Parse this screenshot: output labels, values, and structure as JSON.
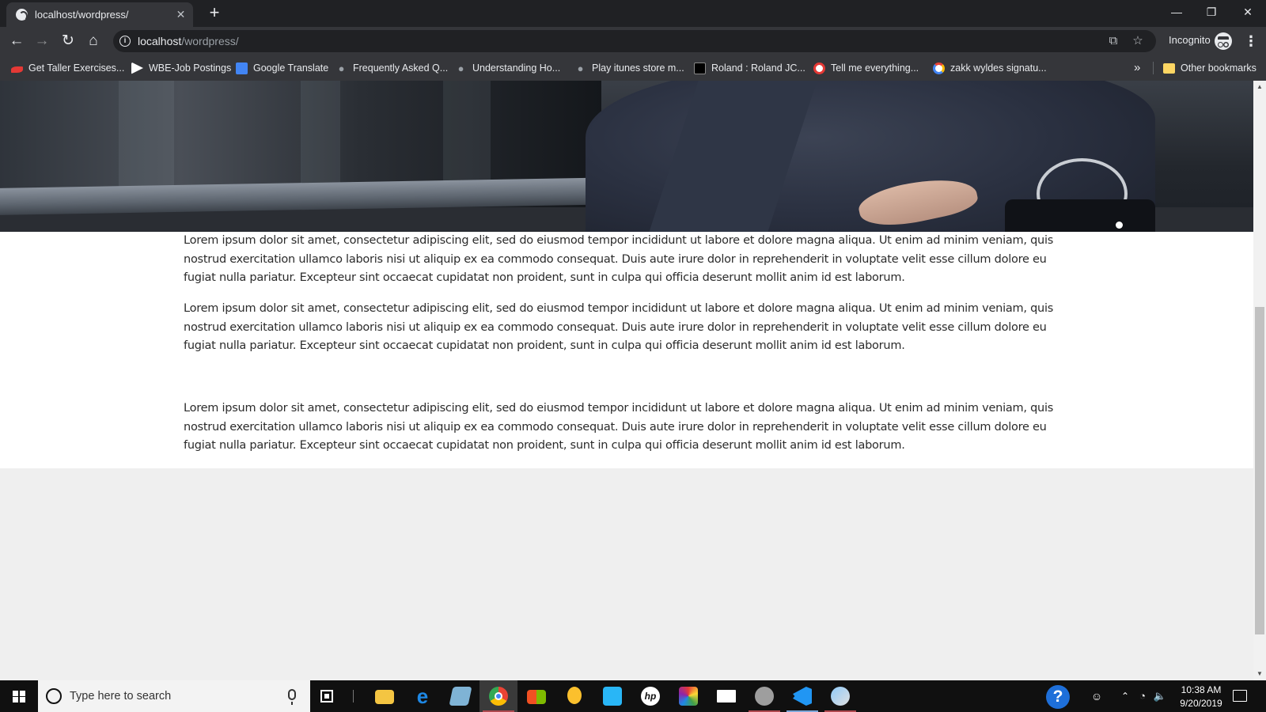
{
  "browser": {
    "tab_title": "localhost/wordpress/",
    "url_host": "localhost",
    "url_path": "/wordpress/",
    "profile_label": "Incognito",
    "window_controls": {
      "minimize": "—",
      "restore": "❐",
      "close": "✕"
    }
  },
  "bookmarks": {
    "items": [
      {
        "label": "Get Taller Exercises...",
        "icon": "red-swoosh-icon",
        "color": "#e53935"
      },
      {
        "label": "WBE-Job Postings",
        "icon": "arrow-logo-icon",
        "color": "#ffffff"
      },
      {
        "label": "Google Translate",
        "icon": "google-translate-icon",
        "color": "#4285f4"
      },
      {
        "label": "Frequently Asked Q...",
        "icon": "apple-icon",
        "color": "#9aa0a6"
      },
      {
        "label": "Understanding Ho...",
        "icon": "apple-icon",
        "color": "#9aa0a6"
      },
      {
        "label": "Play itunes store m...",
        "icon": "apple-icon",
        "color": "#9aa0a6"
      },
      {
        "label": "Roland : Roland JC...",
        "icon": "roland-icon",
        "color": "#000000"
      },
      {
        "label": "Tell me everything...",
        "icon": "target-icon",
        "color": "#e53935"
      },
      {
        "label": "zakk wyldes signatu...",
        "icon": "google-icon",
        "color": "#ffffff"
      }
    ],
    "more": "»",
    "other_label": "Other bookmarks"
  },
  "page": {
    "paragraphs": [
      "Lorem ipsum dolor sit amet, consectetur adipiscing elit, sed do eiusmod tempor incididunt ut labore et dolore magna aliqua. Ut enim ad minim veniam, quis nostrud exercitation ullamco laboris nisi ut aliquip ex ea commodo consequat. Duis aute irure dolor in reprehenderit in voluptate velit esse cillum dolore eu fugiat nulla pariatur. Excepteur sint occaecat cupidatat non proident, sunt in culpa qui officia deserunt mollit anim id est laborum.",
      "Lorem ipsum dolor sit amet, consectetur adipiscing elit, sed do eiusmod tempor incididunt ut labore et dolore magna aliqua. Ut enim ad minim veniam, quis nostrud exercitation ullamco laboris nisi ut aliquip ex ea commodo consequat. Duis aute irure dolor in reprehenderit in voluptate velit esse cillum dolore eu fugiat nulla pariatur. Excepteur sint occaecat cupidatat non proident, sunt in culpa qui officia deserunt mollit anim id est laborum.",
      "Lorem ipsum dolor sit amet, consectetur adipiscing elit, sed do eiusmod tempor incididunt ut labore et dolore magna aliqua. Ut enim ad minim veniam, quis nostrud exercitation ullamco laboris nisi ut aliquip ex ea commodo consequat. Duis aute irure dolor in reprehenderit in voluptate velit esse cillum dolore eu fugiat nulla pariatur. Excepteur sint occaecat cupidatat non proident, sunt in culpa qui officia deserunt mollit anim id est laborum."
    ]
  },
  "taskbar": {
    "search_placeholder": "Type here to search",
    "clock_time": "10:38 AM",
    "clock_date": "9/20/2019",
    "pinned": [
      {
        "name": "file-explorer-icon",
        "color": "#f4c542"
      },
      {
        "name": "edge-icon",
        "color": "#1e88e5"
      },
      {
        "name": "notes-app-icon",
        "color": "#7fb3d5"
      },
      {
        "name": "chrome-icon",
        "color": "#ea4335"
      },
      {
        "name": "store-icon",
        "color": "#ffb300"
      },
      {
        "name": "media-app-icon",
        "color": "#fbc02d"
      },
      {
        "name": "sharp-app-icon",
        "color": "#29b6f6"
      },
      {
        "name": "hp-icon",
        "color": "#ffffff"
      },
      {
        "name": "paint-icon",
        "color": "#8e24aa"
      },
      {
        "name": "mail-icon",
        "color": "#ffffff"
      },
      {
        "name": "github-icon",
        "color": "#9e9e9e"
      },
      {
        "name": "vscode-icon",
        "color": "#2196f3"
      },
      {
        "name": "paint3d-icon",
        "color": "#90caf9"
      }
    ]
  }
}
